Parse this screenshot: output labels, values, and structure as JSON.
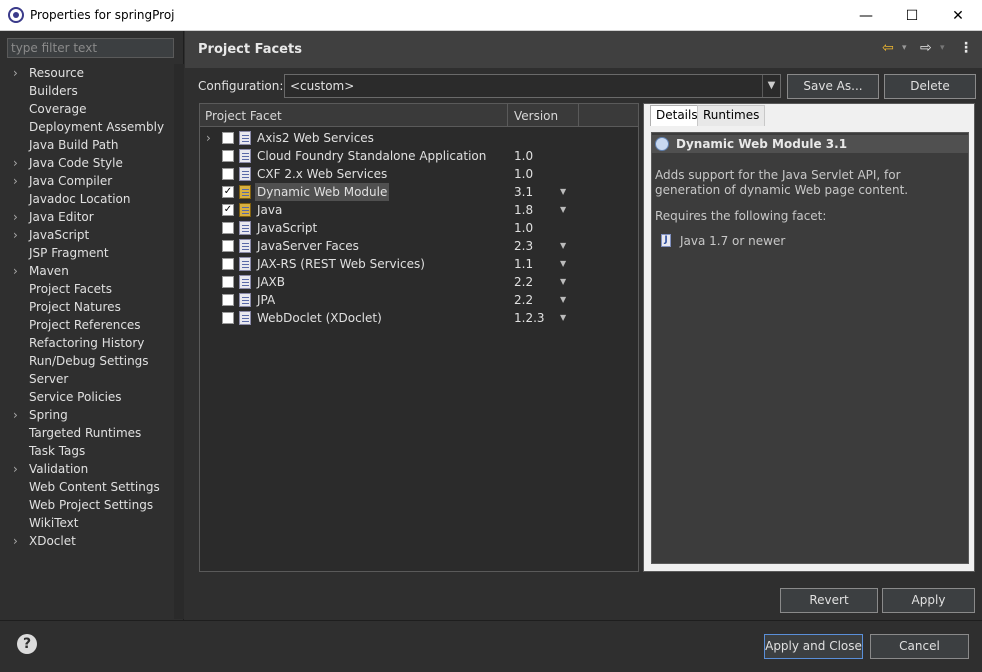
{
  "window": {
    "title": "Properties for springProj",
    "minimize": "—",
    "maximize": "☐",
    "close": "✕"
  },
  "left": {
    "filter_placeholder": "type filter text",
    "items": [
      {
        "label": "Resource",
        "expandable": true
      },
      {
        "label": "Builders",
        "expandable": false
      },
      {
        "label": "Coverage",
        "expandable": false
      },
      {
        "label": "Deployment Assembly",
        "expandable": false
      },
      {
        "label": "Java Build Path",
        "expandable": false
      },
      {
        "label": "Java Code Style",
        "expandable": true
      },
      {
        "label": "Java Compiler",
        "expandable": true
      },
      {
        "label": "Javadoc Location",
        "expandable": false
      },
      {
        "label": "Java Editor",
        "expandable": true
      },
      {
        "label": "JavaScript",
        "expandable": true
      },
      {
        "label": "JSP Fragment",
        "expandable": false
      },
      {
        "label": "Maven",
        "expandable": true
      },
      {
        "label": "Project Facets",
        "expandable": false
      },
      {
        "label": "Project Natures",
        "expandable": false
      },
      {
        "label": "Project References",
        "expandable": false
      },
      {
        "label": "Refactoring History",
        "expandable": false
      },
      {
        "label": "Run/Debug Settings",
        "expandable": false
      },
      {
        "label": "Server",
        "expandable": false
      },
      {
        "label": "Service Policies",
        "expandable": false
      },
      {
        "label": "Spring",
        "expandable": true
      },
      {
        "label": "Targeted Runtimes",
        "expandable": false
      },
      {
        "label": "Task Tags",
        "expandable": false
      },
      {
        "label": "Validation",
        "expandable": true
      },
      {
        "label": "Web Content Settings",
        "expandable": false
      },
      {
        "label": "Web Project Settings",
        "expandable": false
      },
      {
        "label": "WikiText",
        "expandable": false
      },
      {
        "label": "XDoclet",
        "expandable": true
      }
    ]
  },
  "header": {
    "title": "Project Facets",
    "back_icon": "back-arrow-icon",
    "forward_icon": "forward-arrow-icon",
    "menu_icon": "kebab-menu-icon"
  },
  "config": {
    "label": "Configuration:",
    "value": "<custom>",
    "save_as": "Save As...",
    "delete": "Delete"
  },
  "facets": {
    "col_facet": "Project Facet",
    "col_version": "Version",
    "rows": [
      {
        "name": "Axis2 Web Services",
        "version": "",
        "checked": false,
        "expandable": true,
        "dropdown": false
      },
      {
        "name": "Cloud Foundry Standalone Application",
        "version": "1.0",
        "checked": false,
        "expandable": false,
        "dropdown": false
      },
      {
        "name": "CXF 2.x Web Services",
        "version": "1.0",
        "checked": false,
        "expandable": false,
        "dropdown": false
      },
      {
        "name": "Dynamic Web Module",
        "version": "3.1",
        "checked": true,
        "expandable": false,
        "dropdown": true,
        "selected": true
      },
      {
        "name": "Java",
        "version": "1.8",
        "checked": true,
        "expandable": false,
        "dropdown": true
      },
      {
        "name": "JavaScript",
        "version": "1.0",
        "checked": false,
        "expandable": false,
        "dropdown": false
      },
      {
        "name": "JavaServer Faces",
        "version": "2.3",
        "checked": false,
        "expandable": false,
        "dropdown": true
      },
      {
        "name": "JAX-RS (REST Web Services)",
        "version": "1.1",
        "checked": false,
        "expandable": false,
        "dropdown": true
      },
      {
        "name": "JAXB",
        "version": "2.2",
        "checked": false,
        "expandable": false,
        "dropdown": true
      },
      {
        "name": "JPA",
        "version": "2.2",
        "checked": false,
        "expandable": false,
        "dropdown": true
      },
      {
        "name": "WebDoclet (XDoclet)",
        "version": "1.2.3",
        "checked": false,
        "expandable": false,
        "dropdown": true
      }
    ]
  },
  "details": {
    "tab_details": "Details",
    "tab_runtimes": "Runtimes",
    "title": "Dynamic Web Module 3.1",
    "description": "Adds support for the Java Servlet API, for generation of dynamic Web page content.",
    "requires": "Requires the following facet:",
    "java_req": "Java 1.7 or newer"
  },
  "buttons": {
    "revert": "Revert",
    "apply": "Apply",
    "apply_close": "Apply and Close",
    "cancel": "Cancel",
    "help": "?"
  },
  "colors": {
    "accent": "#5a8fd8",
    "background": "#2f2f2f"
  }
}
